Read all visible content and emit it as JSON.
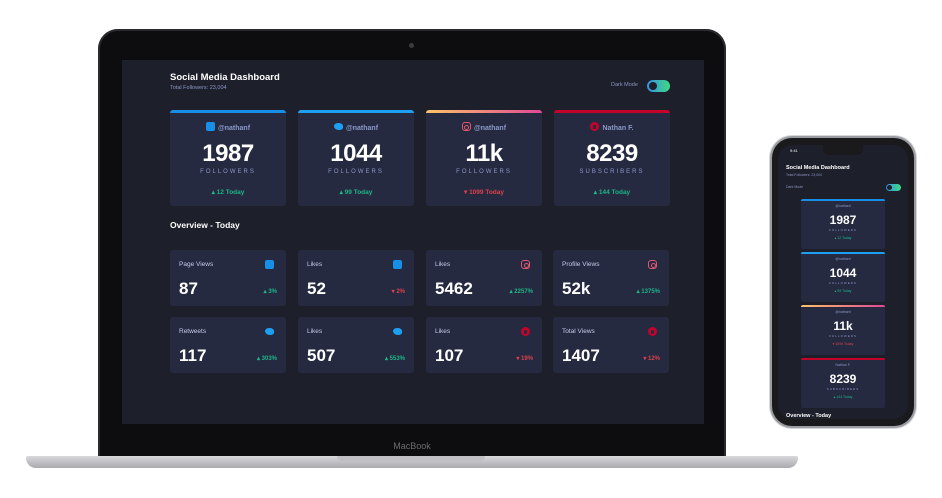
{
  "desktop": {
    "title": "Social Media Dashboard",
    "subtitle": "Total Followers: 23,004",
    "dark_mode_label": "Dark Mode",
    "laptop_brand": "MacBook",
    "overview_title": "Overview - Today",
    "cards": [
      {
        "network": "facebook",
        "icon": "facebook-icon",
        "handle": "@nathanf",
        "count": "1987",
        "label": "FOLLOWERS",
        "change": "▴ 12 Today",
        "trend": "up",
        "accent": "#178fe6"
      },
      {
        "network": "twitter",
        "icon": "twitter-icon",
        "handle": "@nathanf",
        "count": "1044",
        "label": "FOLLOWERS",
        "change": "▴ 99 Today",
        "trend": "up",
        "accent": "#1da0f2"
      },
      {
        "network": "instagram",
        "icon": "instagram-icon",
        "handle": "@nathanf",
        "count": "11k",
        "label": "FOLLOWERS",
        "change": "▾ 1099 Today",
        "trend": "down",
        "accent": "#df4996"
      },
      {
        "network": "youtube",
        "icon": "youtube-icon",
        "handle": "Nathan F.",
        "count": "8239",
        "label": "SUBSCRIBERS",
        "change": "▴ 144 Today",
        "trend": "up",
        "accent": "#c4032b"
      }
    ],
    "overview": [
      {
        "title": "Page Views",
        "icon": "facebook-icon",
        "value": "87",
        "change": "▴ 3%",
        "trend": "up"
      },
      {
        "title": "Likes",
        "icon": "facebook-icon",
        "value": "52",
        "change": "▾ 2%",
        "trend": "down"
      },
      {
        "title": "Likes",
        "icon": "instagram-icon",
        "value": "5462",
        "change": "▴ 2257%",
        "trend": "up"
      },
      {
        "title": "Profile Views",
        "icon": "instagram-icon",
        "value": "52k",
        "change": "▴ 1375%",
        "trend": "up"
      },
      {
        "title": "Retweets",
        "icon": "twitter-icon",
        "value": "117",
        "change": "▴ 303%",
        "trend": "up"
      },
      {
        "title": "Likes",
        "icon": "twitter-icon",
        "value": "507",
        "change": "▴ 553%",
        "trend": "up"
      },
      {
        "title": "Likes",
        "icon": "youtube-icon",
        "value": "107",
        "change": "▾ 19%",
        "trend": "down"
      },
      {
        "title": "Total Views",
        "icon": "youtube-icon",
        "value": "1407",
        "change": "▾ 12%",
        "trend": "down"
      }
    ]
  },
  "mobile": {
    "time": "9:41",
    "title": "Social Media Dashboard",
    "subtitle": "Total Followers: 23,004",
    "dark_mode_label": "Dark Mode",
    "overview_title": "Overview - Today",
    "cards": [
      {
        "handle": "@nathanf",
        "count": "1987",
        "label": "FOLLOWERS",
        "change": "▴ 12 Today",
        "trend": "up",
        "accent": "#178fe6"
      },
      {
        "handle": "@nathanf",
        "count": "1044",
        "label": "FOLLOWERS",
        "change": "▴ 99 Today",
        "trend": "up",
        "accent": "#1da0f2"
      },
      {
        "handle": "@nathanf",
        "count": "11k",
        "label": "FOLLOWERS",
        "change": "▾ 1099 Today",
        "trend": "down",
        "accent": "#df4996"
      },
      {
        "handle": "Nathan F.",
        "count": "8239",
        "label": "SUBSCRIBERS",
        "change": "▴ 144 Today",
        "trend": "up",
        "accent": "#c4032b"
      }
    ]
  }
}
